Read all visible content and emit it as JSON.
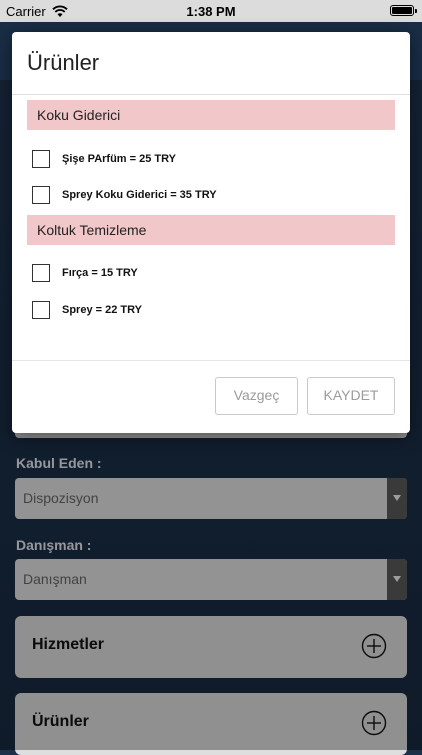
{
  "status_bar": {
    "carrier": "Carrier",
    "time": "1:38 PM"
  },
  "form": {
    "kabul_eden": {
      "label": "Kabul Eden :",
      "value": "Dispozisyon"
    },
    "danisman": {
      "label": "Danışman :",
      "value": "Danışman"
    },
    "sections": [
      {
        "title": "Hizmetler"
      },
      {
        "title": "Ürünler"
      }
    ]
  },
  "modal": {
    "title": "Ürünler",
    "categories": [
      {
        "name": "Koku Giderici",
        "items": [
          {
            "label": "Şişe PArfüm = 25 TRY",
            "checked": false
          },
          {
            "label": "Sprey Koku Giderici = 35 TRY",
            "checked": false
          }
        ]
      },
      {
        "name": "Koltuk Temizleme",
        "items": [
          {
            "label": "Fırça = 15 TRY",
            "checked": false
          },
          {
            "label": "Sprey = 22 TRY",
            "checked": false
          }
        ]
      }
    ],
    "cancel_label": "Vazgeç",
    "save_label": "KAYDET"
  }
}
